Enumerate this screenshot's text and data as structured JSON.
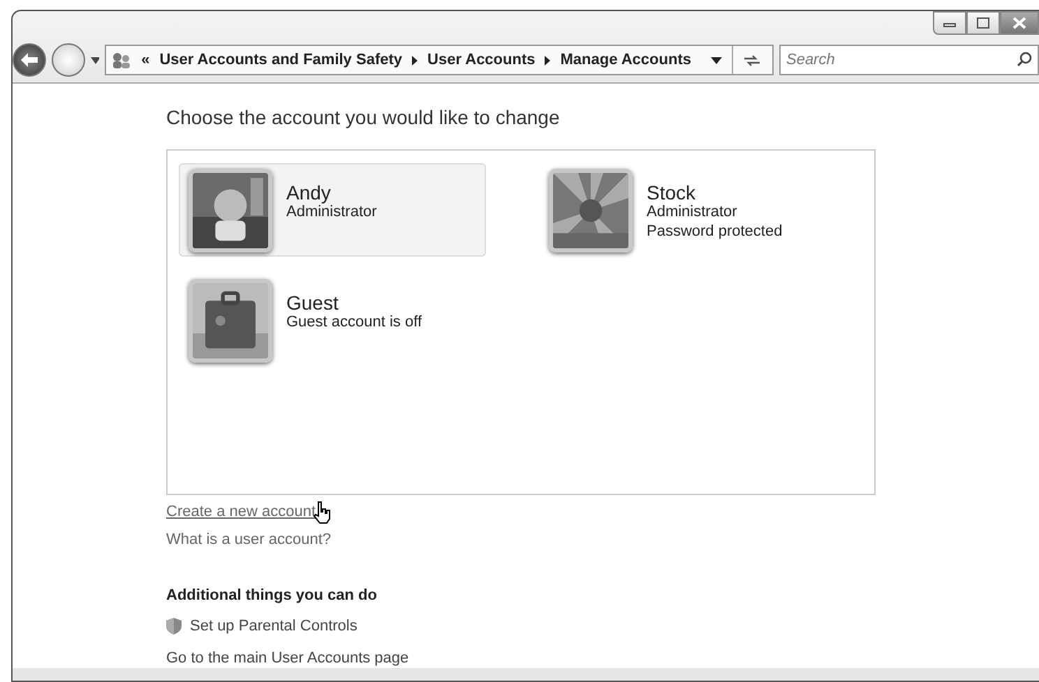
{
  "address_bar": {
    "crumbs": [
      "«",
      "User Accounts and Family Safety",
      "User Accounts",
      "Manage Accounts"
    ]
  },
  "search": {
    "placeholder": "Search"
  },
  "heading": "Choose the account you would like to change",
  "accounts": [
    {
      "name": "Andy",
      "details": [
        "Administrator"
      ],
      "selected": true
    },
    {
      "name": "Stock",
      "details": [
        "Administrator",
        "Password protected"
      ],
      "selected": false
    },
    {
      "name": "Guest",
      "details": [
        "Guest account is off"
      ],
      "selected": false
    }
  ],
  "links": [
    "Create a new account",
    "What is a user account?"
  ],
  "additional": {
    "title": "Additional things you can do",
    "items": [
      {
        "label": "Set up Parental Controls",
        "kind": "shield"
      },
      {
        "label": "Go to the main User Accounts page",
        "kind": "plain"
      }
    ]
  }
}
